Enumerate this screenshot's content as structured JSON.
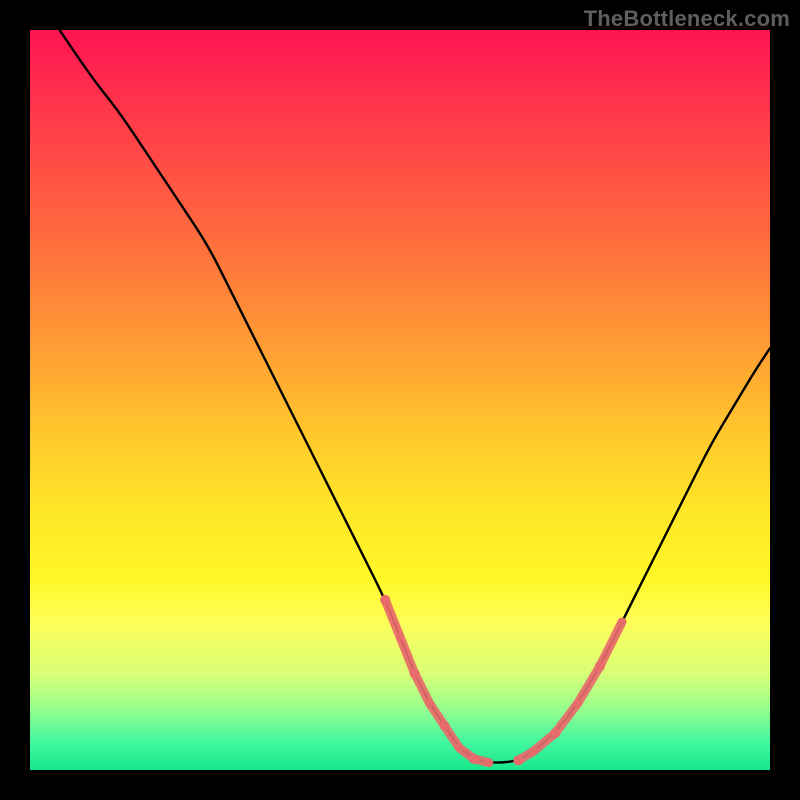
{
  "watermark": "TheBottleneck.com",
  "chart_data": {
    "type": "line",
    "title": "",
    "xlabel": "",
    "ylabel": "",
    "xlim": [
      0,
      100
    ],
    "ylim": [
      0,
      100
    ],
    "series": [
      {
        "name": "curve",
        "x": [
          4,
          8,
          12,
          16,
          20,
          24,
          27,
          30,
          33,
          36,
          39,
          42,
          45,
          48,
          50,
          52,
          54,
          56,
          58,
          60,
          62,
          64,
          66,
          68,
          71,
          74,
          77,
          80,
          83,
          86,
          89,
          92,
          95,
          98,
          100
        ],
        "y": [
          100,
          94,
          89,
          83,
          77,
          71,
          65,
          59,
          53,
          47,
          41,
          35,
          29,
          23,
          18,
          13,
          9,
          6,
          3,
          1.5,
          1,
          1,
          1.3,
          2.5,
          5,
          9,
          14,
          20,
          26,
          32,
          38,
          44,
          49,
          54,
          57
        ]
      }
    ],
    "highlight_segments": [
      {
        "index_range": [
          13,
          20
        ],
        "color": "#e86b6b",
        "width": 9
      },
      {
        "index_range": [
          22,
          27
        ],
        "color": "#e86b6b",
        "width": 9
      }
    ],
    "colors": {
      "curve": "#000000",
      "highlight": "#e86b6b",
      "background_gradient_top": "#ff1452",
      "background_gradient_bottom": "#17e88b",
      "frame": "#000000"
    }
  }
}
